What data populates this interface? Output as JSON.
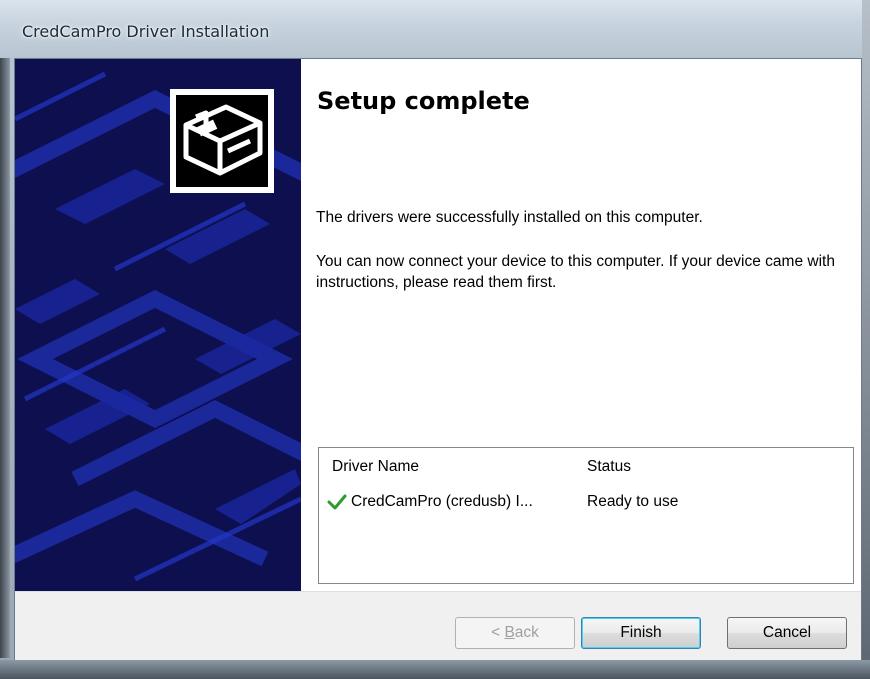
{
  "window": {
    "title": "CredCamPro Driver Installation"
  },
  "banner": {
    "icon": "hardware-installer-icon",
    "background_color": "#0d0f4f"
  },
  "content": {
    "heading": "Setup complete",
    "message_1": "The drivers were successfully installed on this computer.",
    "message_2": "You can now connect your device to this computer. If your device came with instructions, please read them first."
  },
  "driver_list": {
    "columns": [
      "Driver Name",
      "Status"
    ],
    "rows": [
      {
        "icon": "green-check-icon",
        "name": "CredCamPro (credusb) I...",
        "status": "Ready to use"
      }
    ]
  },
  "buttons": {
    "back_prefix": "< ",
    "back_accel": "B",
    "back_rest": "ack",
    "finish": "Finish",
    "cancel": "Cancel"
  },
  "colors": {
    "check": "#2e9a2e",
    "default_button_border": "#3c7fb1"
  }
}
